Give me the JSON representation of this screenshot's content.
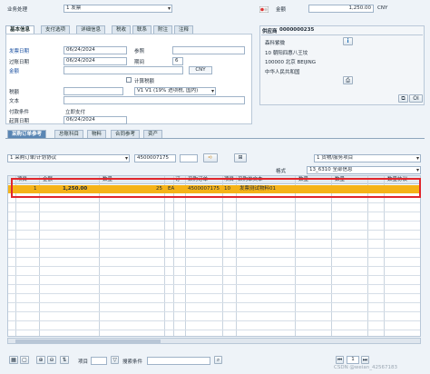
{
  "header": {
    "transaction_label": "业务处理",
    "transaction_value": "1 发票",
    "amount_label": "金额",
    "amount_value": "1,250.00",
    "currency": "CNY"
  },
  "tabs": [
    "基本信息",
    "支付选项",
    "详细信息",
    "税收",
    "联系",
    "附注",
    "注释"
  ],
  "basic": {
    "invoice_date_label": "发票日期",
    "invoice_date": "06/24/2024",
    "reference_label": "参照",
    "posting_date_label": "过账日期",
    "posting_date": "06/24/2024",
    "period_label": "期间",
    "period": "6",
    "amount_label": "金额",
    "amount_currency": "CNY",
    "calc_tax_label": "计算税额",
    "tax_label": "税额",
    "tax_code": "V1 V1 (19% 进项税, 国内)",
    "text_label": "文本",
    "payment_cond_label": "付款条件",
    "payment_cond_value": "立即支付",
    "baseline_label": "起算日期",
    "baseline_date": "06/24/2024"
  },
  "vendor": {
    "title": "供应商",
    "number": "0000000235",
    "lines": [
      "森科紫微",
      "10 朝阳四惠八王坟",
      "100000 北京 BEIJING",
      "中华人民共和国"
    ]
  },
  "item_tabs": [
    "采购订单参考",
    "总账科目",
    "物料",
    "合同参考",
    "资产"
  ],
  "item_controls": {
    "ref_type": "1 采购订单/计划协议",
    "po_number": "4500007175",
    "item_category": "1 货物/服务项目",
    "layout_label": "格式",
    "layout_value": "13_6310 全部信息"
  },
  "grid": {
    "headers": [
      "项目",
      "金额",
      "数量",
      "订",
      "采购订单",
      "项目",
      "采购单文本",
      "数量",
      "数量",
      "数量协议"
    ],
    "row": {
      "item": "1",
      "amount": "1,250.00",
      "qty": "25",
      "unit": "EA",
      "po": "4500007175",
      "po_item": "10",
      "text": "发票测试物料01"
    }
  },
  "footer": {
    "item_label": "项目",
    "search_label": "搜索条件",
    "page": "1"
  },
  "watermark": "CSDN @weian_42567183"
}
